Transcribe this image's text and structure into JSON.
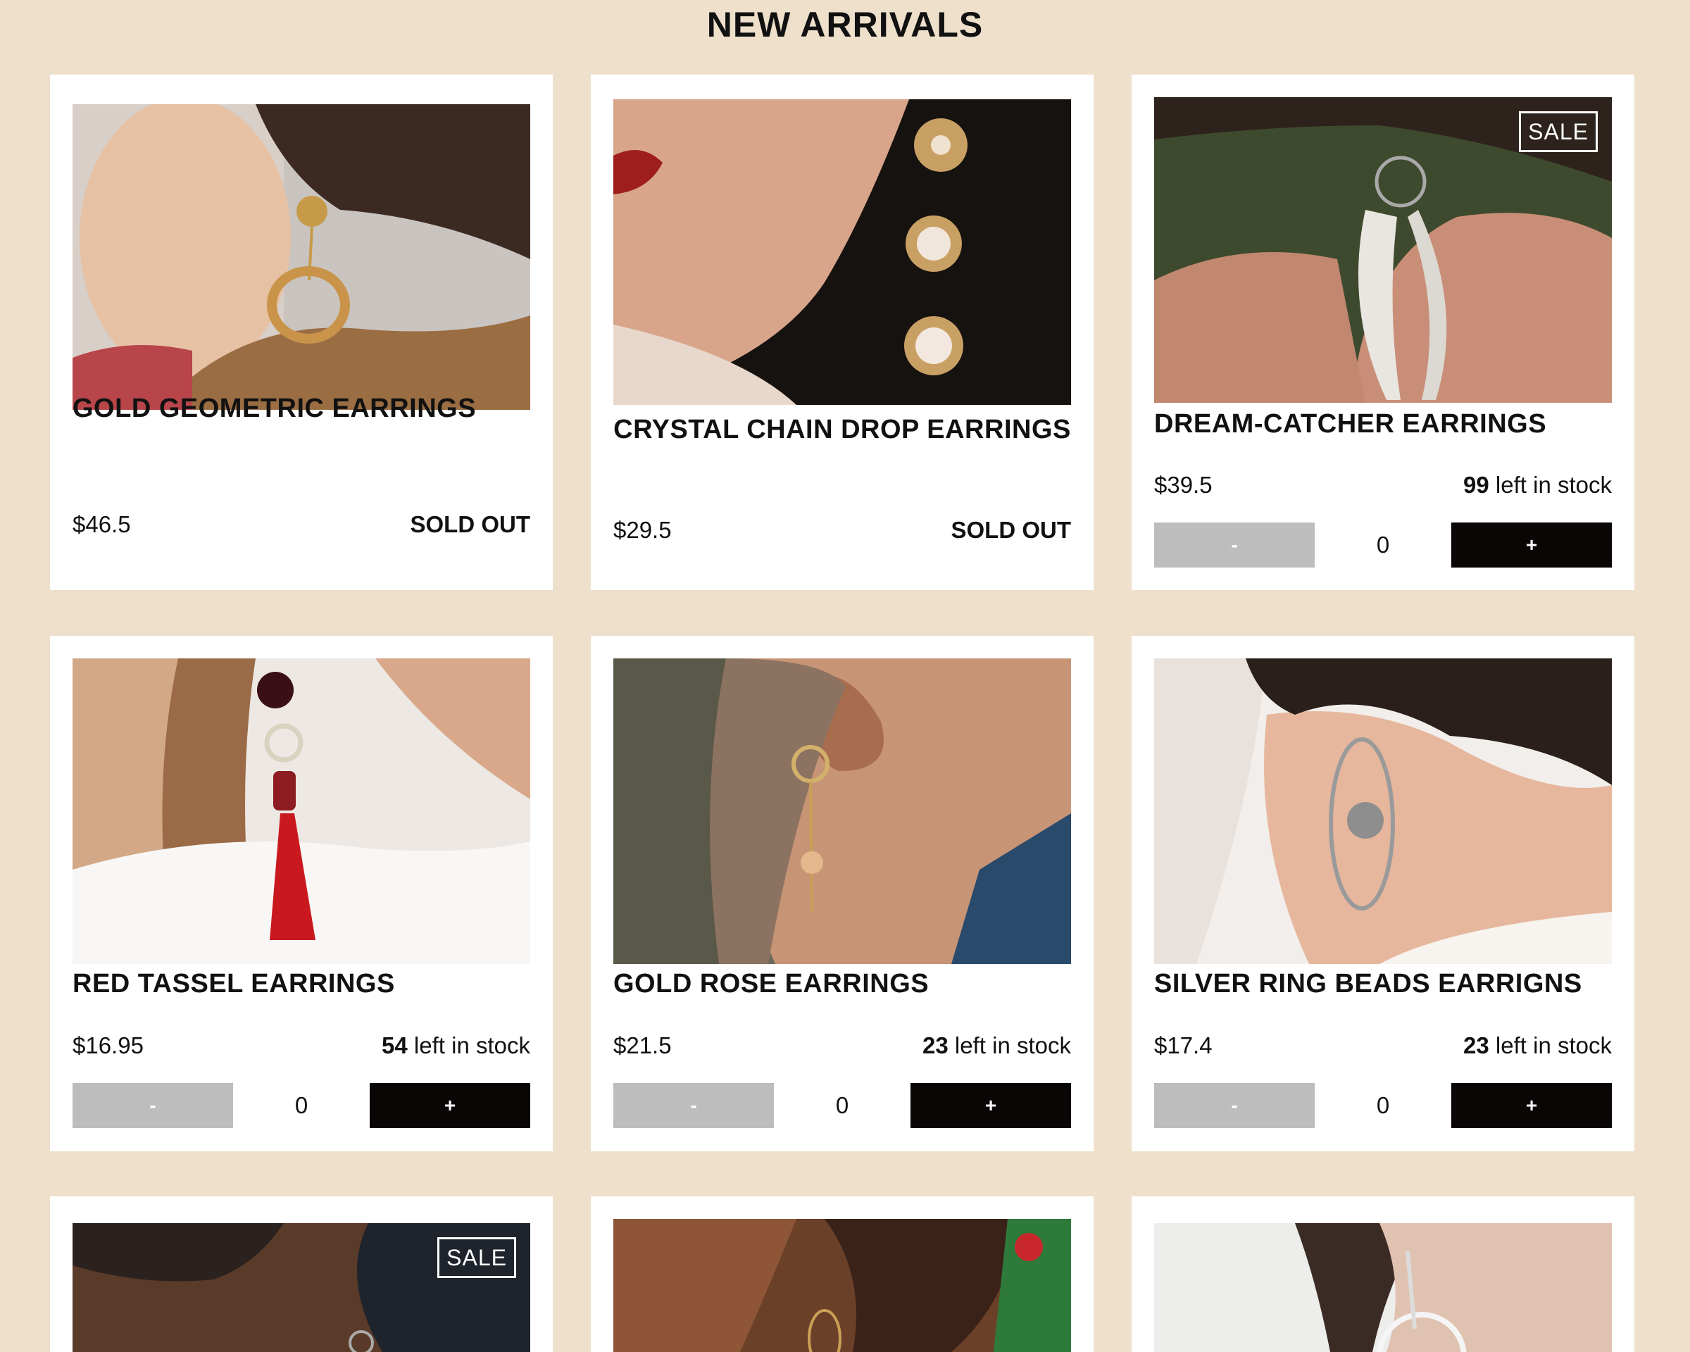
{
  "page": {
    "title": "NEW ARRIVALS"
  },
  "products": [
    {
      "name": "GOLD GEOMETRIC EARRINGS",
      "price": "$46.5",
      "status": "SOLD OUT",
      "sale_badge": ""
    },
    {
      "name": "CRYSTAL CHAIN DROP EARRINGS",
      "price": "$29.5",
      "status": "SOLD OUT",
      "sale_badge": ""
    },
    {
      "name": "DREAM-CATCHER EARRINGS",
      "price": "$39.5",
      "stock_count": "99",
      "stock_suffix": "left in stock",
      "quantity": "0",
      "minus_label": "-",
      "plus_label": "+",
      "sale_badge": "SALE"
    },
    {
      "name": "RED TASSEL EARRINGS",
      "price": "$16.95",
      "stock_count": "54",
      "stock_suffix": "left in stock",
      "quantity": "0",
      "minus_label": "-",
      "plus_label": "+",
      "sale_badge": ""
    },
    {
      "name": "GOLD ROSE EARRINGS",
      "price": "$21.5",
      "stock_count": "23",
      "stock_suffix": "left in stock",
      "quantity": "0",
      "minus_label": "-",
      "plus_label": "+",
      "sale_badge": ""
    },
    {
      "name": "SILVER RING BEADS EARRIGNS",
      "price": "$17.4",
      "stock_count": "23",
      "stock_suffix": "left in stock",
      "quantity": "0",
      "minus_label": "-",
      "plus_label": "+",
      "sale_badge": ""
    },
    {
      "sale_badge": "SALE"
    },
    {
      "sale_badge": ""
    },
    {
      "sale_badge": ""
    }
  ],
  "colors": {
    "background": "#efe0cc",
    "card": "#ffffff",
    "minus_button": "#bdbdbd",
    "plus_button": "#0b0606"
  }
}
